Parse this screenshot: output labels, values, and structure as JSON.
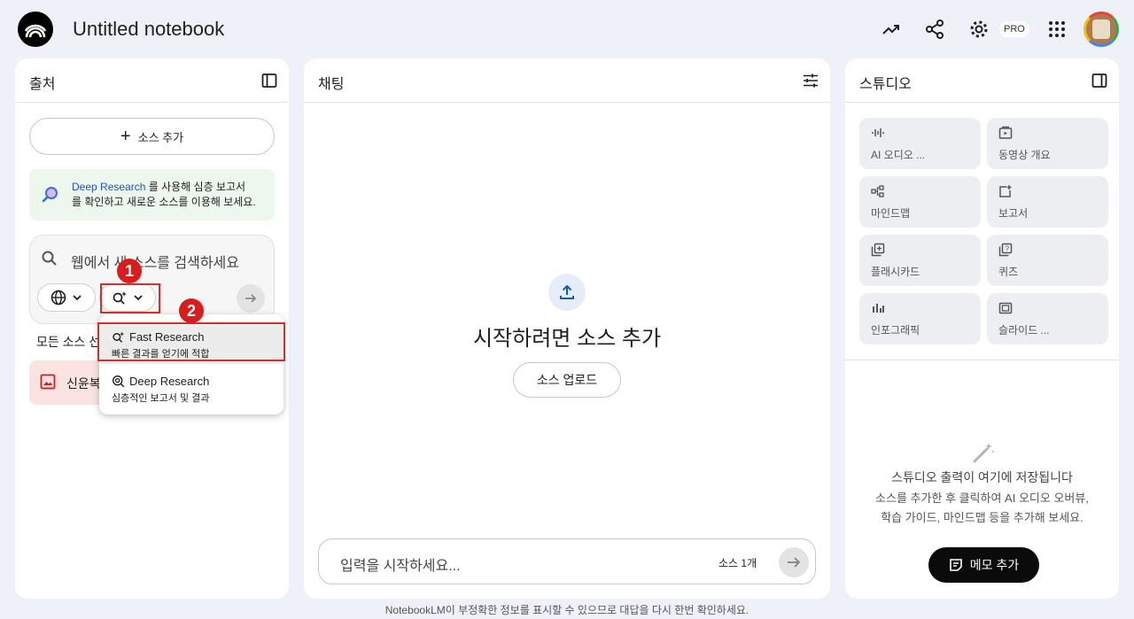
{
  "app": {
    "title": "Untitled notebook",
    "pro_badge": "PRO"
  },
  "header_icons": [
    "analytics-icon",
    "share-icon",
    "settings-icon",
    "apps-grid-icon"
  ],
  "sources": {
    "title": "출처",
    "add_button": "소스 추가",
    "banner_link": "Deep Research",
    "banner_text_1": " 를 사용해 심층 보고서",
    "banner_text_2": "를 확인하고 새로운 소스를 이용해 보세요.",
    "search_placeholder": "웹에서 새 소스를 검색하세요",
    "all_sources": "모든 소스 선택",
    "source_item": "신윤복"
  },
  "annotations": {
    "marker1": "1",
    "marker2": "2"
  },
  "dropdown": {
    "items": [
      {
        "title": "Fast Research",
        "subtitle": "빠른 결과를 얻기에 적합",
        "icon": "fast-research-icon"
      },
      {
        "title": "Deep Research",
        "subtitle": "심층적인 보고서 및 결과",
        "icon": "deep-research-icon"
      }
    ]
  },
  "chat": {
    "title": "채팅",
    "heading": "시작하려면 소스 추가",
    "upload_button": "소스 업로드",
    "input_placeholder": "입력을 시작하세요...",
    "source_count": "소스 1개"
  },
  "studio": {
    "title": "스튜디오",
    "tiles": [
      {
        "label": "AI 오디오 ...",
        "icon": "audio-icon"
      },
      {
        "label": "동영상 개요",
        "icon": "video-icon"
      },
      {
        "label": "마인드맵",
        "icon": "mindmap-icon"
      },
      {
        "label": "보고서",
        "icon": "report-icon"
      },
      {
        "label": "플래시카드",
        "icon": "flashcard-icon"
      },
      {
        "label": "퀴즈",
        "icon": "quiz-icon"
      },
      {
        "label": "인포그래픽",
        "icon": "infographic-icon"
      },
      {
        "label": "슬라이드 ...",
        "icon": "slides-icon"
      }
    ],
    "empty_title": "스튜디오 출력이 여기에 저장됩니다",
    "empty_desc_1": "소스를 추가한 후 클릭하여 AI 오디오 오버뷰,",
    "empty_desc_2": "학습 가이드, 마인드맵 등을 추가해 보세요.",
    "memo_button": "메모 추가"
  },
  "footer": "NotebookLM이 부정확한 정보를 표시할 수 있으므로 대답을 다시 한번 확인하세요.",
  "colors": {
    "background": "#eef1f8",
    "accent_blue": "#1a56b8",
    "annotation_red": "#d32f2f",
    "source_pink": "#fbe3e1"
  }
}
